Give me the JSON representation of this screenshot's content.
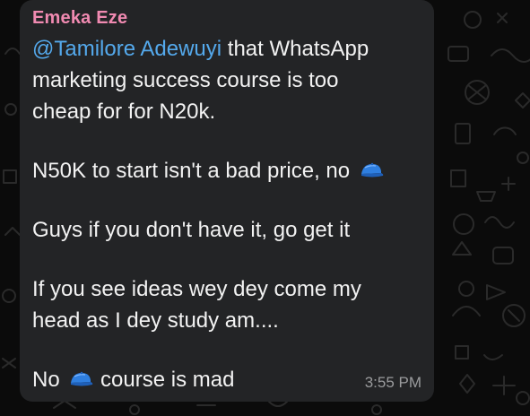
{
  "message": {
    "sender": "Emeka Eze",
    "mention": "@Tamilore Adewuyi",
    "line1_rest": " that WhatsApp",
    "line2": "marketing success course is too",
    "line3": "cheap for for N20k.",
    "line4": "N50K to start isn't a bad price, no",
    "line5": "Guys if you don't have it, go get it",
    "line6": "If you see ideas wey dey come my",
    "line7": "head as I dey study am....",
    "line8_start": "No",
    "line8_end": "course is mad",
    "time": "3:55 PM"
  },
  "colors": {
    "background": "#0b0b0b",
    "bubble": "#232426",
    "sender": "#f08ab1",
    "mention": "#54a9ec",
    "text": "#f2f2f2",
    "time": "#9a9b9d"
  },
  "icons": {
    "emoji": "blue-cap-emoji"
  }
}
